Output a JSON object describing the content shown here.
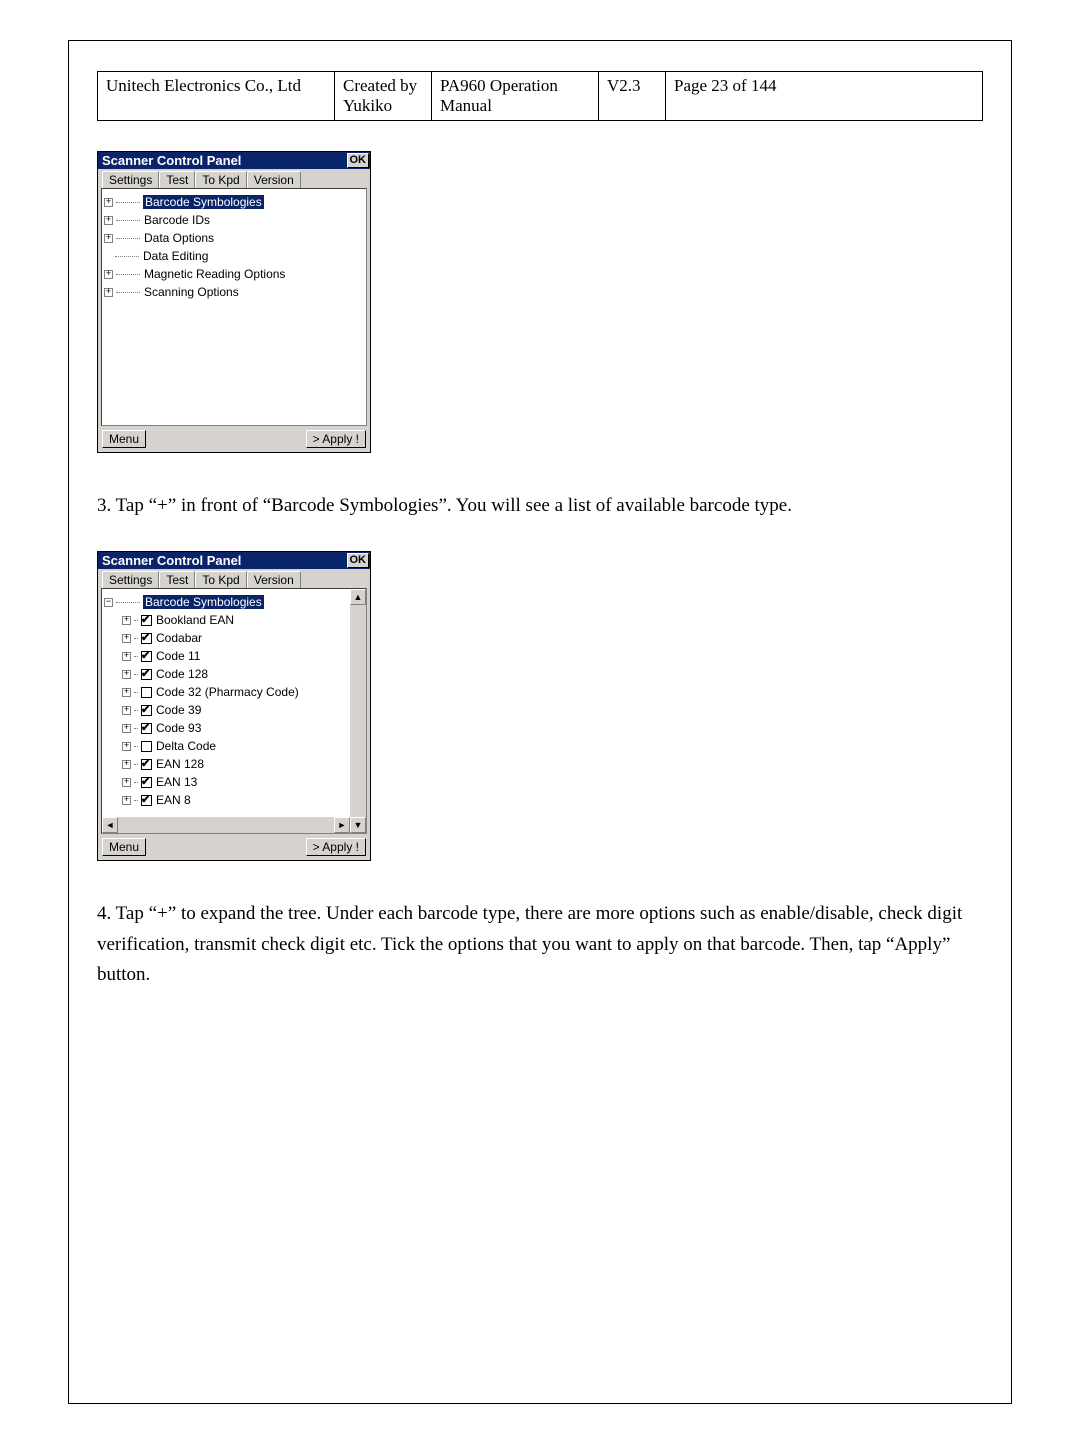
{
  "header": {
    "company": "Unitech Electronics Co., Ltd",
    "created": "Created by Yukiko",
    "doc": "PA960 Operation Manual",
    "ver": "V2.3",
    "page": "Page 23 of 144"
  },
  "panel": {
    "title": "Scanner Control Panel",
    "ok": "OK",
    "menu": "Menu",
    "apply": "> Apply !"
  },
  "tabs": {
    "t1": "Settings",
    "t2": "Test",
    "t3": "To Kpd",
    "t4": "Version"
  },
  "tree1": {
    "n1": "Barcode Symbologies",
    "n2": "Barcode IDs",
    "n3": "Data Options",
    "n4": "Data Editing",
    "n5": "Magnetic Reading Options",
    "n6": "Scanning Options"
  },
  "tree2": {
    "root": "Barcode Symbologies",
    "i1": "Bookland EAN",
    "i2": "Codabar",
    "i3": "Code 11",
    "i4": "Code 128",
    "i5": "Code 32 (Pharmacy Code)",
    "i6": "Code 39",
    "i7": "Code 93",
    "i8": "Delta Code",
    "i9": "EAN 128",
    "i10": "EAN 13",
    "i11": "EAN 8"
  },
  "step3": "3. Tap “+” in front of “Barcode Symbologies”. You will see a list of available barcode type.",
  "step4": "4. Tap “+” to expand the tree. Under each barcode type, there are more options such as enable/disable, check digit verification, transmit check digit etc. Tick the options that you want to apply on that barcode. Then, tap “Apply” button."
}
